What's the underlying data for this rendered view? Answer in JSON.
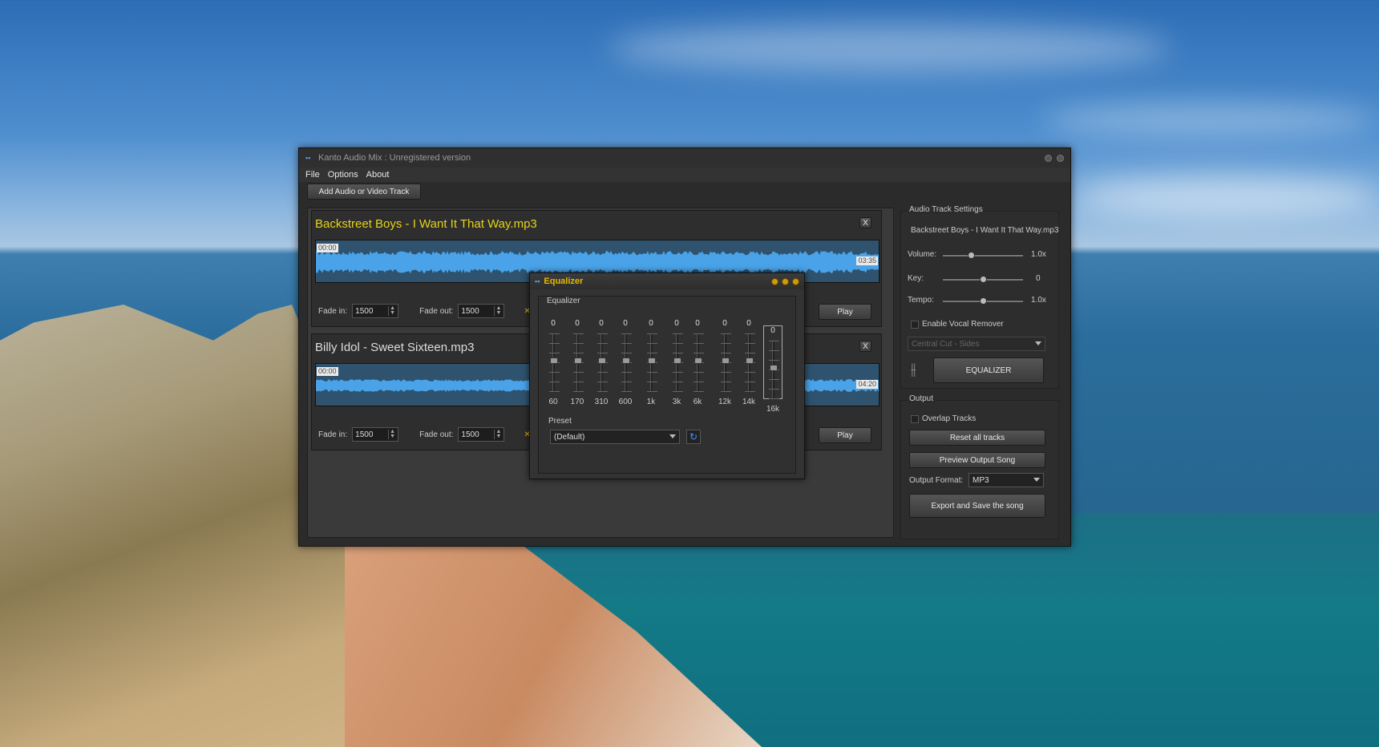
{
  "window": {
    "title": "Kanto Audio Mix : Unregistered version"
  },
  "menu": [
    "File",
    "Options",
    "About"
  ],
  "toolbar": {
    "add_track": "Add Audio or Video Track"
  },
  "tracks": [
    {
      "name": "Backstreet Boys - I Want It That Way.mp3",
      "name_color": "#e6d21c",
      "start": "00:00",
      "end": "03:35",
      "fade_in_label": "Fade in:",
      "fade_in": "1500",
      "fade_out_label": "Fade out:",
      "fade_out": "1500",
      "checkbox": "E",
      "play": "Play",
      "close": "X"
    },
    {
      "name": "Billy Idol - Sweet Sixteen.mp3",
      "name_color": "#dddddd",
      "start": "00:00",
      "end": "04:20",
      "fade_in_label": "Fade in:",
      "fade_in": "1500",
      "fade_out_label": "Fade out:",
      "fade_out": "1500",
      "checkbox": "E",
      "play": "Play",
      "close": "X"
    }
  ],
  "settings": {
    "group_title": "Audio Track Settings",
    "track_name": "Backstreet Boys - I Want It That Way.mp3",
    "volume_label": "Volume:",
    "volume_value": "1.0x",
    "volume_level": 0.35,
    "key_label": "Key:",
    "key_value": "0",
    "key_level": 0.5,
    "tempo_label": "Tempo:",
    "tempo_value": "1.0x",
    "tempo_level": 0.5,
    "vocal_remover_label": "Enable Vocal Remover",
    "vocal_mode": "Central Cut - Sides",
    "equalizer_button": "EQUALIZER"
  },
  "output": {
    "group_title": "Output",
    "overlap_label": "Overlap Tracks",
    "reset_button": "Reset all tracks",
    "preview_button": "Preview Output Song",
    "format_label": "Output Format:",
    "format_value": "MP3",
    "export_button": "Export and Save the song"
  },
  "equalizer": {
    "title": "Equalizer",
    "group_title": "Equalizer",
    "bands": [
      {
        "freq": "60",
        "value": "0"
      },
      {
        "freq": "170",
        "value": "0"
      },
      {
        "freq": "310",
        "value": "0"
      },
      {
        "freq": "600",
        "value": "0"
      },
      {
        "freq": "1k",
        "value": "0"
      },
      {
        "freq": "3k",
        "value": "0"
      },
      {
        "freq": "6k",
        "value": "0"
      },
      {
        "freq": "12k",
        "value": "0"
      },
      {
        "freq": "14k",
        "value": "0"
      },
      {
        "freq": "16k",
        "value": "0"
      }
    ],
    "preset_label": "Preset",
    "preset_value": "(Default)"
  }
}
